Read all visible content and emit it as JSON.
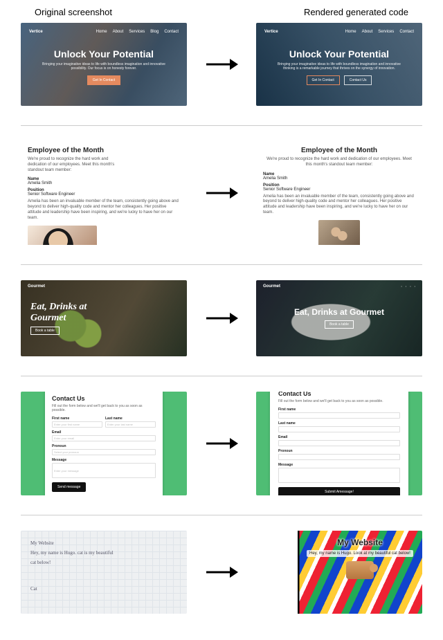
{
  "headers": {
    "left": "Original screenshot",
    "right": "Rendered generated code"
  },
  "ex1": {
    "brand": "Vertice",
    "nav": [
      "Home",
      "About",
      "Services",
      "Blog",
      "Contact"
    ],
    "title": "Unlock Your Potential",
    "subtitle_left": "Bringing your imaginative ideas to life with boundless imagination and innovative possibility. Our focus is on honesty forever.",
    "subtitle_right": "Bringing your imaginative ideas to life with boundless imagination and innovative thinking is a remarkable journey that thrives on the synergy of innovation.",
    "cta1": "Get In Contact",
    "cta2": "Contact Us"
  },
  "ex2": {
    "title": "Employee of the Month",
    "lead_left": "We're proud to recognize the hard work and dedication of our employees. Meet this month's standout team member:",
    "lead_right": "We're proud to recognize the hard work and dedication of our employees. Meet this month's standout team member:",
    "name_label": "Name",
    "name_value": "Amelia Smith",
    "position_label": "Position",
    "position_value": "Senior Software Engineer",
    "desc": "Amelia has been an invaluable member of the team, consistently going above and beyond to deliver high-quality code and mentor her colleagues. Her positive attitude and leadership have been inspiring, and we're lucky to have her on our team."
  },
  "ex3": {
    "brand": "Gourmet",
    "title_left": "Eat, Drinks at Gourmet",
    "title_right": "Eat, Drinks at Gourmet",
    "cta": "Book a table"
  },
  "ex4": {
    "title": "Contact Us",
    "subtitle": "Fill out the form below and we'll get back to you as soon as possible.",
    "first_name": "First name",
    "last_name": "Last name",
    "email": "Email",
    "pronoun": "Pronoun",
    "select_pronoun": "Select your pronoun",
    "message": "Message",
    "first_ph": "Enter your first name",
    "last_ph": "Enter your last name",
    "email_ph": "Enter your email",
    "msg_ph": "Enter your message",
    "submit_left": "Send message",
    "submit_right": "Submit Amessage!"
  },
  "ex5": {
    "sketch_title": "My Website",
    "sketch_line1": "Hey, my name is Hugo.   cat is my beautiful",
    "sketch_line2": "cat below!",
    "sketch_cat": "Cat",
    "right_title": "My Website",
    "right_text": "Hey, my name is Hugo. Look at my beautiful cat below!"
  }
}
